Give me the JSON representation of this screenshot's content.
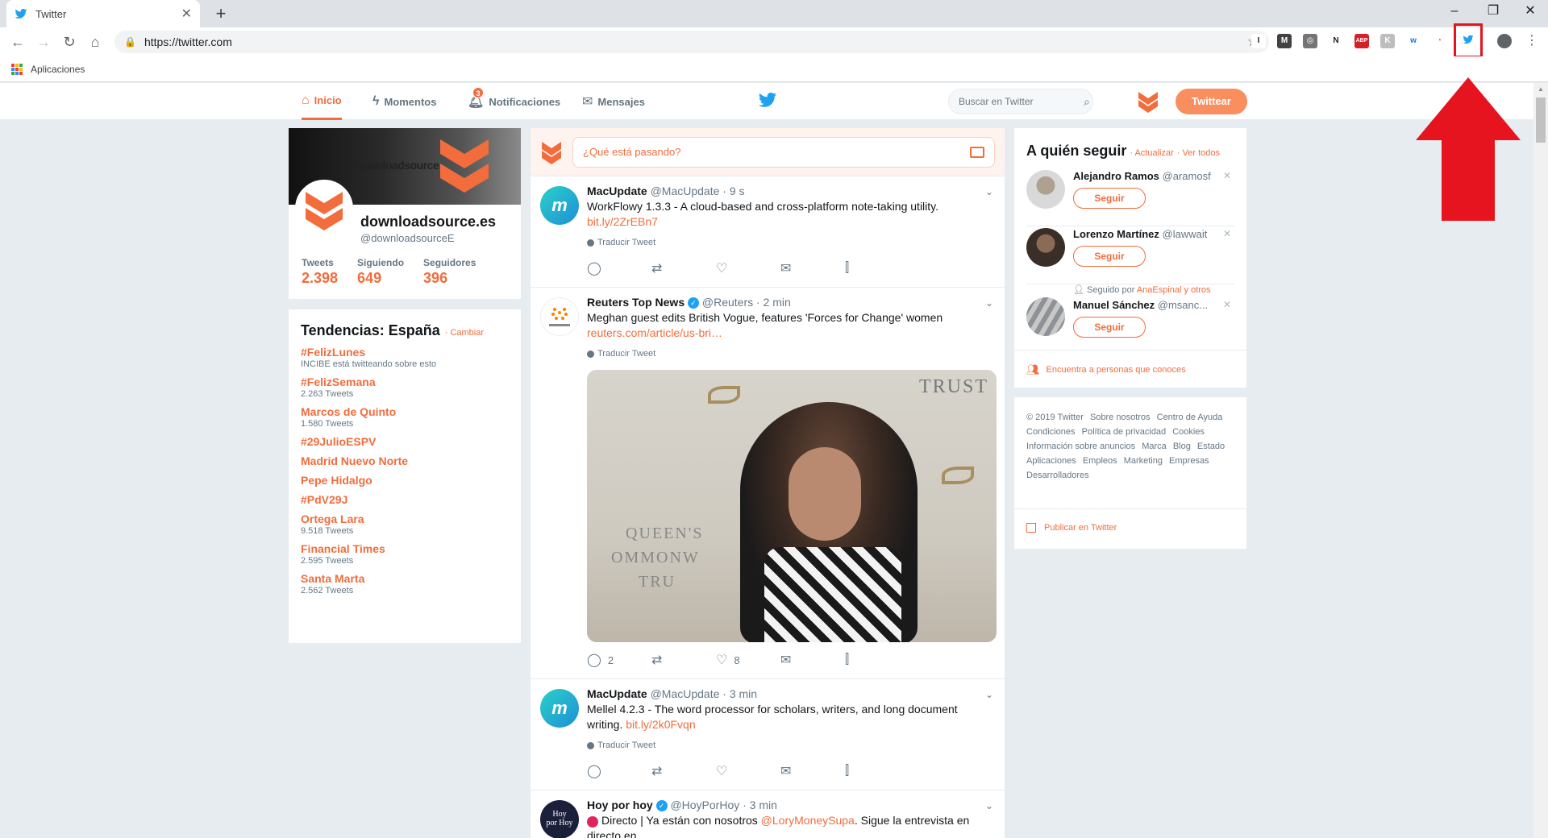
{
  "browser": {
    "tab_title": "Twitter",
    "url": "https://twitter.com",
    "bookmark_apps": "Aplicaciones",
    "extensions": [
      {
        "label": "I",
        "color": "#ffffff",
        "fg": "#202124"
      },
      {
        "label": "M",
        "color": "#424242",
        "fg": "#ffffff"
      },
      {
        "label": "◎",
        "color": "#757575",
        "fg": "#ffffff"
      },
      {
        "label": "N",
        "color": "#ffffff",
        "fg": "#202124"
      },
      {
        "label": "ABP",
        "color": "#d61f26",
        "fg": "#ffffff"
      },
      {
        "label": "K",
        "color": "#bdbdbd",
        "fg": "#ffffff"
      },
      {
        "label": "w",
        "color": "#ffffff",
        "fg": "#1a73e8"
      },
      {
        "label": "◔",
        "color": "#ffffff",
        "fg": "#f26c3c"
      }
    ]
  },
  "nav": {
    "home": "Inicio",
    "moments": "Momentos",
    "notifications": "Notificaciones",
    "notifications_count": "3",
    "messages": "Mensajes",
    "search_placeholder": "Buscar en Twitter",
    "tweet_button": "Twittear"
  },
  "profile": {
    "banner_text": "downloadsource",
    "name": "downloadsource.es",
    "handle": "@downloadsourceE",
    "stats": [
      {
        "label": "Tweets",
        "value": "2.398"
      },
      {
        "label": "Siguiendo",
        "value": "649"
      },
      {
        "label": "Seguidores",
        "value": "396"
      }
    ]
  },
  "trends": {
    "title": "Tendencias: España",
    "change": "· Cambiar",
    "items": [
      {
        "name": "#FelizLunes",
        "meta": "INCIBE está twitteando sobre esto"
      },
      {
        "name": "#FelizSemana",
        "meta": "2.263 Tweets"
      },
      {
        "name": "Marcos de Quinto",
        "meta": "1.580 Tweets"
      },
      {
        "name": "#29JulioESPV",
        "meta": ""
      },
      {
        "name": "Madrid Nuevo Norte",
        "meta": ""
      },
      {
        "name": "Pepe Hidalgo",
        "meta": ""
      },
      {
        "name": "#PdV29J",
        "meta": ""
      },
      {
        "name": "Ortega Lara",
        "meta": "9.518 Tweets"
      },
      {
        "name": "Financial Times",
        "meta": "2.595 Tweets"
      },
      {
        "name": "Santa Marta",
        "meta": "2.562 Tweets"
      }
    ]
  },
  "compose": {
    "placeholder": "¿Qué está pasando?"
  },
  "tweets": [
    {
      "name": "MacUpdate",
      "handle": "@MacUpdate · 9 s",
      "text": "WorkFlowy 1.3.3 - A cloud-based and cross-platform note-taking utility.",
      "link": "bit.ly/2ZrEBn7",
      "translate": "Traducir Tweet",
      "replies": "",
      "likes": ""
    },
    {
      "name": "Reuters Top News",
      "handle": "@Reuters · 2 min",
      "text": "Meghan guest edits British Vogue, features 'Forces for Change' women",
      "link": "reuters.com/article/us-bri…",
      "translate": "Traducir Tweet",
      "replies": "2",
      "likes": "8",
      "photo_text1": "TRUST",
      "photo_text2": "QUEEN'S",
      "photo_text3": "OMMONW",
      "photo_text4": "TRU"
    },
    {
      "name": "MacUpdate",
      "handle": "@MacUpdate · 3 min",
      "text": "Mellel 4.2.3 - The word processor for scholars, writers, and long document writing.",
      "link": "bit.ly/2k0Fvqn",
      "translate": "Traducir Tweet",
      "replies": "",
      "likes": ""
    },
    {
      "name": "Hoy por hoy",
      "handle": "@HoyPorHoy · 3 min",
      "text": "Directo | Ya están con nosotros",
      "mention": "@LoryMoneySupa",
      "text2": ". Sigue la entrevista en directo en"
    }
  ],
  "who_to_follow": {
    "title": "A quién seguir",
    "refresh": "· Actualizar",
    "view_all": "· Ver todos",
    "follow_label": "Seguir",
    "followed_by_prefix": "Seguido por",
    "followed_by_name": "AnaEspinal y otros",
    "users": [
      {
        "name": "Alejandro Ramos",
        "handle": "@aramosf"
      },
      {
        "name": "Lorenzo Martínez",
        "handle": "@lawwait"
      },
      {
        "name": "Manuel Sánchez",
        "handle": "@msanc..."
      }
    ],
    "find_people": "Encuentra a personas que conoces"
  },
  "footer": {
    "links": [
      "© 2019 Twitter",
      "Sobre nosotros",
      "Centro de Ayuda",
      "Condiciones",
      "Política de privacidad",
      "Cookies",
      "Información sobre anuncios",
      "Marca",
      "Blog",
      "Estado",
      "Aplicaciones",
      "Empleos",
      "Marketing",
      "Empresas",
      "Desarrolladores"
    ],
    "publish": "Publicar en Twitter"
  },
  "colors": {
    "accent": "#f26c3c",
    "twitter_blue": "#1da1f2",
    "annotation_red": "#e5141e"
  }
}
